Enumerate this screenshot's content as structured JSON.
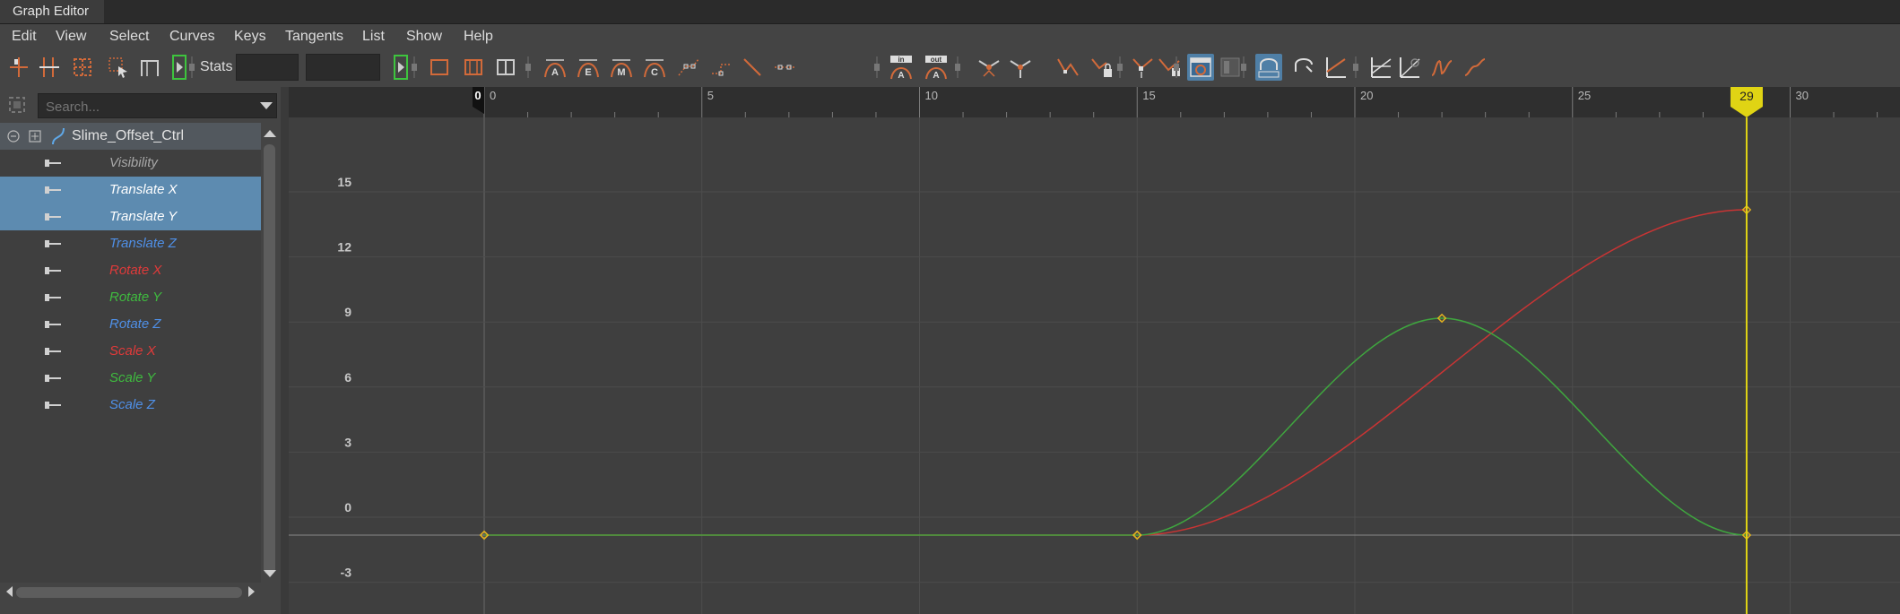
{
  "window": {
    "title": "Graph Editor"
  },
  "menu": [
    "Edit",
    "View",
    "Select",
    "Curves",
    "Keys",
    "Tangents",
    "List",
    "Show",
    "Help"
  ],
  "toolbar": {
    "stats_label": "Stats",
    "stats_value_1": "",
    "stats_value_2": "",
    "icons": [
      "move-nearest-key-icon",
      "insert-key-icon",
      "lattice-deform-icon",
      "region-select-icon",
      "time-snap-icon",
      "play-range-icon",
      "frame-all-icon",
      "frame-playback-icon",
      "center-current-time-icon",
      "auto-tangent-icon",
      "spline-tangent-icon",
      "clamped-tangent-icon",
      "linear-tangent-icon",
      "flat-tangent-icon",
      "step-tangent-icon",
      "step-next-tangent-icon",
      "plateau-tangent-icon",
      "in-tangent-icon",
      "out-tangent-icon",
      "break-tangents-icon",
      "unify-tangents-icon",
      "free-tangent-weight-icon",
      "lock-tangent-weight-icon",
      "buffer-curve-icon",
      "swap-buffer-icon",
      "snapshot-icon",
      "retime-tool-icon",
      "normalize-icon",
      "denormalize-icon",
      "stacked-view-icon",
      "pre-infinity-cycle-icon",
      "pre-infinity-offset-icon",
      "post-infinity-cycle-icon",
      "post-infinity-offset-icon"
    ]
  },
  "outliner": {
    "search_placeholder": "Search...",
    "node": {
      "label": "Slime_Offset_Ctrl"
    },
    "attributes": [
      {
        "label": "Visibility",
        "color": "#a8a8a8",
        "selected": false
      },
      {
        "label": "Translate X",
        "color": "#ffffff",
        "selected": true
      },
      {
        "label": "Translate Y",
        "color": "#ffffff",
        "selected": true
      },
      {
        "label": "Translate Z",
        "color": "#4f90e8",
        "selected": false
      },
      {
        "label": "Rotate X",
        "color": "#e03a3a",
        "selected": false
      },
      {
        "label": "Rotate Y",
        "color": "#3fbb3f",
        "selected": false
      },
      {
        "label": "Rotate Z",
        "color": "#4f90e8",
        "selected": false
      },
      {
        "label": "Scale X",
        "color": "#e03a3a",
        "selected": false
      },
      {
        "label": "Scale Y",
        "color": "#3fbb3f",
        "selected": false
      },
      {
        "label": "Scale Z",
        "color": "#4f90e8",
        "selected": false
      }
    ]
  },
  "graph": {
    "current_frame": "29",
    "start_marker": "0",
    "time_ticks": [
      "0",
      "5",
      "10",
      "15",
      "20",
      "25",
      "30"
    ],
    "value_ticks": [
      "15",
      "12",
      "9",
      "6",
      "3",
      "0",
      "-3"
    ],
    "time_range": [
      0,
      32
    ],
    "value_range": [
      -4,
      18
    ],
    "curves": [
      {
        "name": "Translate X",
        "color": "#c93434",
        "keys": [
          [
            0,
            0
          ],
          [
            15,
            0
          ],
          [
            29,
            15
          ]
        ]
      },
      {
        "name": "Translate Y",
        "color": "#3fa53f",
        "keys": [
          [
            0,
            0
          ],
          [
            15,
            0
          ],
          [
            22,
            10
          ],
          [
            29,
            0
          ]
        ]
      }
    ],
    "colors": {
      "background": "#3f3f3f",
      "grid": "#4d4d4d",
      "zero_line": "#8a8a8a",
      "current_time": "#e0d414",
      "key": "#e0b020"
    }
  }
}
